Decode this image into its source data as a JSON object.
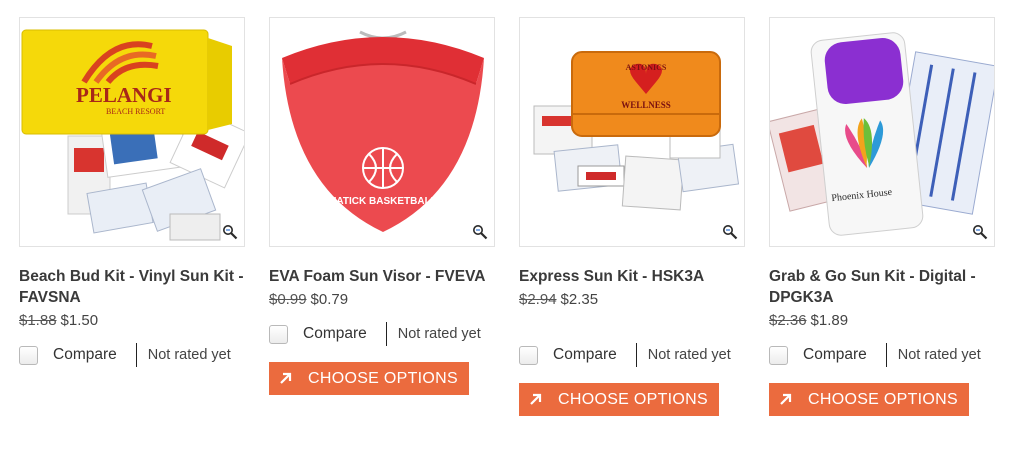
{
  "products": [
    {
      "title": "Beach Bud Kit - Vinyl Sun Kit - FAVSNA",
      "old_price": "$1.88",
      "price": "$1.50",
      "compare_label": "Compare",
      "rating_text": "Not rated yet",
      "has_button": false,
      "image_text": {
        "brand": "PELANGI",
        "sub": "BEACH RESORT"
      },
      "image_colors": {
        "case": "#f5d90a"
      }
    },
    {
      "title": "EVA Foam Sun Visor - FVEVA",
      "old_price": "$0.99",
      "price": "$0.79",
      "compare_label": "Compare",
      "rating_text": "Not rated yet",
      "has_button": true,
      "button_label": "CHOOSE OPTIONS",
      "image_text": {
        "brand": "NATICK BASKETBALL"
      },
      "image_colors": {
        "visor": "#e8383d"
      }
    },
    {
      "title": "Express Sun Kit - HSK3A",
      "old_price": "$2.94",
      "price": "$2.35",
      "compare_label": "Compare",
      "rating_text": "Not rated yet",
      "has_button": true,
      "button_label": "CHOOSE OPTIONS",
      "image_text": {
        "top": "ASTONICS",
        "bottom": "WELLNESS"
      },
      "image_colors": {
        "case": "#f08a1c"
      }
    },
    {
      "title": "Grab & Go Sun Kit - Digital - DPGK3A",
      "old_price": "$2.36",
      "price": "$1.89",
      "compare_label": "Compare",
      "rating_text": "Not rated yet",
      "has_button": true,
      "button_label": "CHOOSE OPTIONS",
      "image_text": {
        "brand": "Phoenix House"
      },
      "image_colors": {
        "lid": "#8b2fd1"
      }
    }
  ],
  "colors": {
    "button": "#eb6b3e",
    "border": "#e2e2e2"
  },
  "icons": {
    "zoom": "magnifier-icon",
    "button_arrow": "arrow-up-right-icon"
  }
}
